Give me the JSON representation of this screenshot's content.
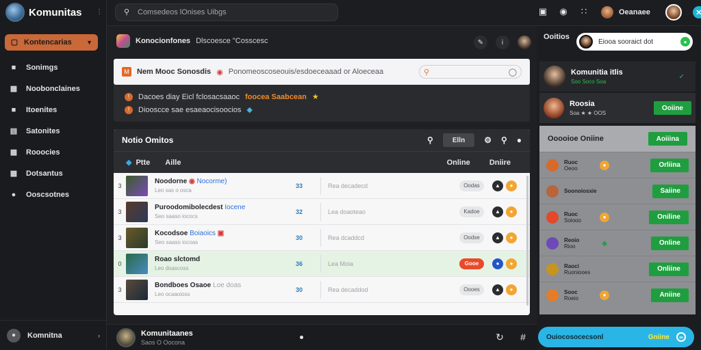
{
  "brand": {
    "title": "Komunitas"
  },
  "sidebar": {
    "select_label": "Kontencarias",
    "items": [
      {
        "label": "Sonimgs",
        "icon": "folder-icon"
      },
      {
        "label": "Noobonclaines",
        "icon": "grid-icon"
      },
      {
        "label": "Itoenites",
        "icon": "folder-icon"
      },
      {
        "label": "Satonites",
        "icon": "list-icon"
      },
      {
        "label": "Rooocies",
        "icon": "grid-icon"
      },
      {
        "label": "Dotsantus",
        "icon": "grid-icon"
      },
      {
        "label": "Ooscsotnes",
        "icon": "circle-icon"
      }
    ],
    "user_label": "Komnitna"
  },
  "topbar": {
    "search_placeholder": "Comsedeos lOnises Uibgs",
    "user_name": "Oeanaee"
  },
  "crumb": {
    "title": "Konocionfones",
    "sub": "Dlscoesce \"Cosscesc"
  },
  "notice": {
    "tag": "M",
    "title": "Nem Mooc Sonosdis",
    "message": "Ponomeoscoseouis/esdoeceaaad or Aloeceaa"
  },
  "alerts": [
    {
      "text": "Dacoes diay Eicl fclosacsaaoc",
      "highlight": "foocea Saabcean"
    },
    {
      "text": "Diooscce sae esaeaocisoocios",
      "highlight": ""
    }
  ],
  "panel": {
    "title": "Notio Omitos",
    "pill": "Elln"
  },
  "columns": {
    "c1": "Ptte",
    "c2": "Aille",
    "c3": "Online",
    "c4": "Dniire"
  },
  "rows": [
    {
      "num": "3",
      "name": "Noodorne",
      "accent": "Nocorme)",
      "sub": "Leo sas o osca",
      "count": "33",
      "desc": "Rea decadecd",
      "chip": "Oodas"
    },
    {
      "num": "3",
      "name": "Puroodomibolecdest",
      "accent": "Iocene",
      "sub": "Seo saaso iococs",
      "count": "32",
      "desc": "Lea doaoteao",
      "chip": "Kadoe"
    },
    {
      "num": "3",
      "name": "Kocodsoe",
      "accent": "Boiaoics",
      "sub": "Seo saaso iocoas",
      "count": "30",
      "desc": "Rea dcaddcd",
      "chip": "Oodse"
    },
    {
      "num": "0",
      "name": "Roao slctomd",
      "accent": "",
      "sub": "Leo doascoss",
      "count": "36",
      "desc": "Lea Moia",
      "chip": "Gooe"
    },
    {
      "num": "3",
      "name": "Bondboes Osaoe",
      "accent": "Loe doas",
      "sub": "Leo ocaaoioss",
      "count": "30",
      "desc": "Rea decaddod",
      "chip": "Oooes"
    }
  ],
  "bottombar": {
    "title": "Komunitaanes",
    "sub": "Saos O Oocona"
  },
  "right": {
    "label": "Ooitios",
    "search_text": "Eiooa sooraict dot",
    "card_title": "Komunitia itlis",
    "card_sub": "Soo Soco Soa",
    "profile_name": "Roosia",
    "profile_sub": "Soa ★ ★ OOS",
    "profile_btn": "Ooiine",
    "list_title": "Ooooioe Oniine",
    "list_btn": "Aoiiina",
    "list_rows": [
      {
        "name": "Ruoc",
        "sub": "Oeoo",
        "btn": "Orliina",
        "color": "#d66a2b"
      },
      {
        "name": "Soonoiosxie",
        "sub": "",
        "btn": "Saiine",
        "color": "#b9643a"
      },
      {
        "name": "Ruoc",
        "sub": "Soiooo",
        "btn": "Oniline",
        "color": "#e3482a"
      },
      {
        "name": "Reoio",
        "sub": "Rioo",
        "btn": "Online",
        "color": "#6d4ab8"
      },
      {
        "name": "Raoci",
        "sub": "Ruoniooes",
        "btn": "Onliine",
        "color": "#c7941e"
      },
      {
        "name": "Sooc",
        "sub": "Roeio",
        "btn": "Aniine",
        "color": "#e57c2a"
      }
    ],
    "bottom_label": "Ouiocosocecsonl",
    "bottom_action": "Gniine"
  }
}
